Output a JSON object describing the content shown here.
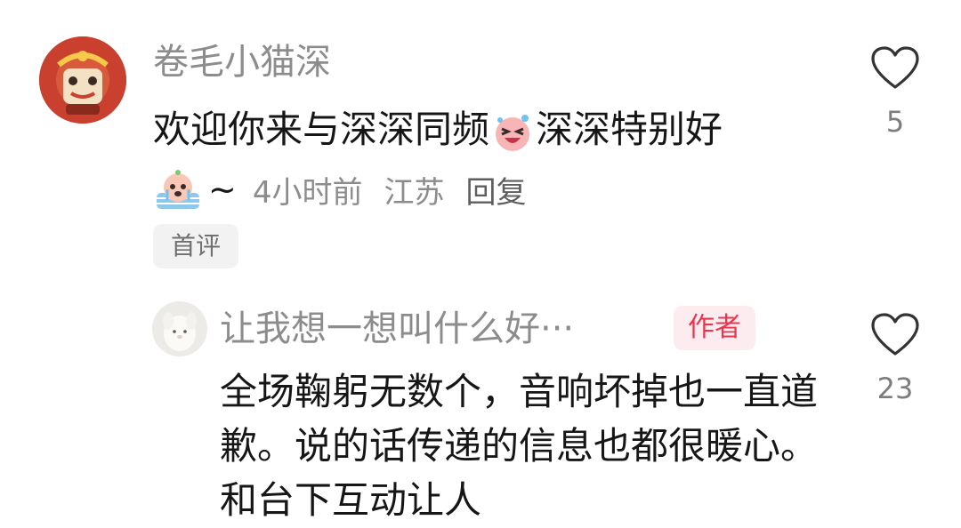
{
  "comments": [
    {
      "username": "卷毛小猫深",
      "text_before_emoji": "欢迎你来与深深同频",
      "text_after_emoji": "深深特别好",
      "emoji_1": "laughing-face-emoji",
      "emoji_2": "crying-face-emoji",
      "tilde": "~",
      "time": "4小时前",
      "location": "江苏",
      "reply_label": "回复",
      "tag": "首评",
      "like_count": "5"
    },
    {
      "username": "让我想一想叫什么好···",
      "badge": "作者",
      "text": "全场鞠躬无数个，音响坏掉也一直道歉。说的话传递的信息也都很暖心。和台下互动让人",
      "like_count": "23"
    }
  ],
  "icons": {
    "like": "heart-outline-icon",
    "avatar1": "lion-dance-avatar",
    "avatar2": "white-plush-avatar"
  },
  "colors": {
    "text": "#161616",
    "muted": "#8c8c8c",
    "author_badge_text": "#e6374f",
    "author_badge_bg": "#fdecef",
    "tag_bg": "#f2f2f2"
  }
}
